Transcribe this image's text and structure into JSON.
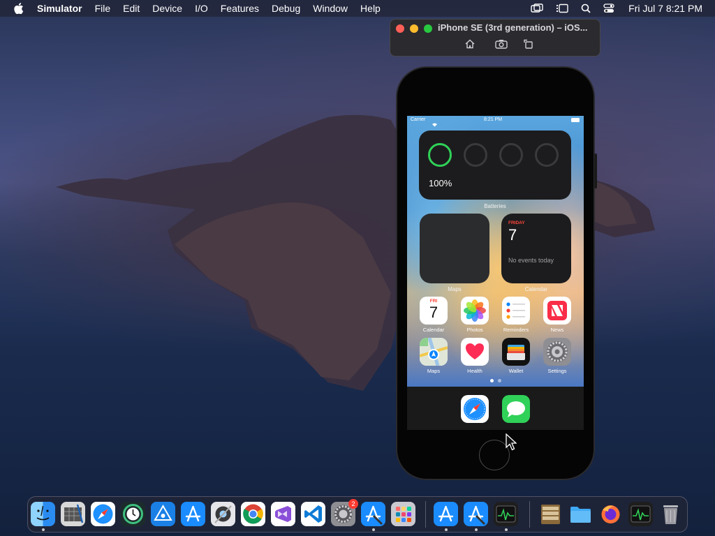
{
  "menubar": {
    "app_name": "Simulator",
    "items": [
      "File",
      "Edit",
      "Device",
      "I/O",
      "Features",
      "Debug",
      "Window",
      "Help"
    ],
    "clock": "Fri Jul 7  8:21 PM",
    "status_icons": [
      "screen-mirroring-icon",
      "stage-manager-icon",
      "search-icon",
      "control-center-icon"
    ]
  },
  "simulator": {
    "title": "iPhone SE (3rd generation) – iOS...",
    "toolbar": [
      "home-icon",
      "screenshot-icon",
      "rotate-icon"
    ],
    "traffic_colors": [
      "#ff5f57",
      "#febc2e",
      "#28c840"
    ]
  },
  "iphone": {
    "status": {
      "carrier": "Carrier",
      "time": "8:21 PM"
    },
    "batteries_widget": {
      "percent": "100%",
      "label": "Batteries"
    },
    "maps_widget": {
      "label": "Maps"
    },
    "calendar_widget": {
      "day": "FRIDAY",
      "date": "7",
      "events": "No events today",
      "label": "Calendar"
    },
    "apps_row1": [
      {
        "name": "Calendar",
        "icon": "calendar-app-icon",
        "day": "FRI",
        "date": "7"
      },
      {
        "name": "Photos",
        "icon": "photos-app-icon"
      },
      {
        "name": "Reminders",
        "icon": "reminders-app-icon"
      },
      {
        "name": "News",
        "icon": "news-app-icon"
      }
    ],
    "apps_row2": [
      {
        "name": "Maps",
        "icon": "maps-app-icon"
      },
      {
        "name": "Health",
        "icon": "health-app-icon"
      },
      {
        "name": "Wallet",
        "icon": "wallet-app-icon"
      },
      {
        "name": "Settings",
        "icon": "settings-app-icon"
      }
    ],
    "dock_apps": [
      "safari-icon",
      "messages-icon"
    ],
    "battery_color": "#30d158"
  },
  "dock": {
    "apps": [
      "finder-icon",
      "system-information-icon",
      "safari-icon",
      "time-machine-icon",
      "testflight-icon",
      "app-store-icon",
      "instruments-icon",
      "google-chrome-icon",
      "visual-studio-icon",
      "vs-code-icon",
      "system-preferences-icon",
      "xcode-icon",
      "launchpad-icon",
      "app-store-2-icon",
      "xcode-2-icon",
      "activity-monitor-icon",
      "archive-utility-icon",
      "folder-icon",
      "firefox-icon",
      "activity-monitor-2-icon",
      "trash-icon"
    ],
    "settings_badge": "2"
  }
}
